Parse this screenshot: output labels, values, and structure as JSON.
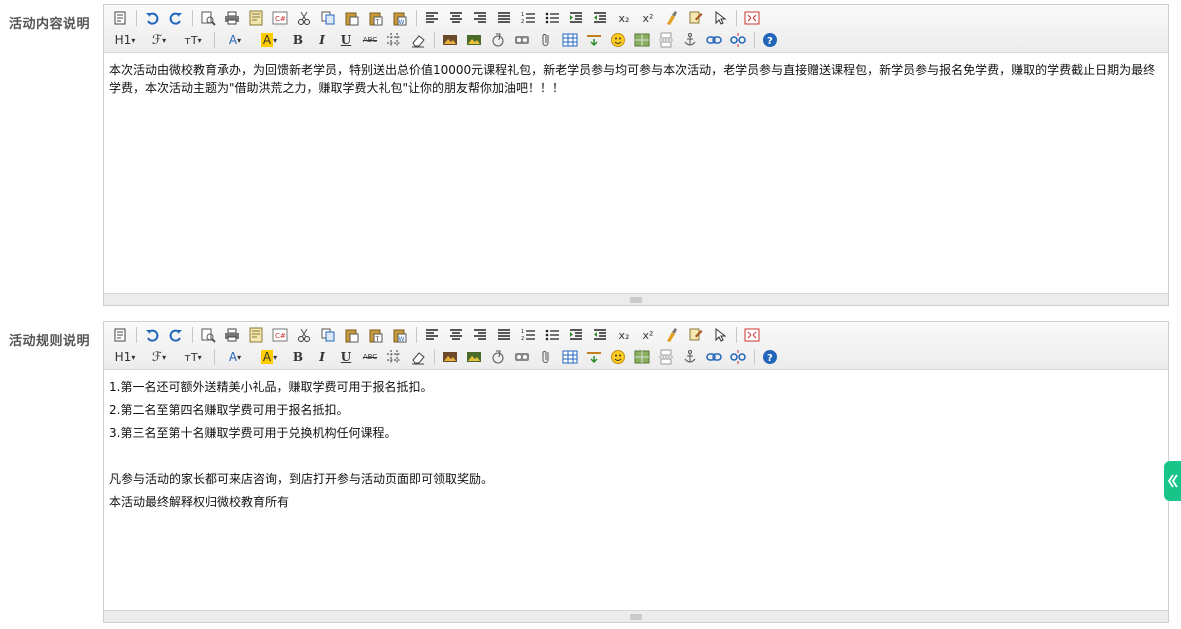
{
  "fields": [
    {
      "label": "活动内容说明",
      "paragraphs": [
        "本次活动由微校教育承办，为回馈新老学员，特别送出总价值10000元课程礼包，新老学员参与均可参与本次活动，老学员参与直接赠送课程包，新学员参与报名免学费，赚取的学费截止日期为最终学费，本次活动主题为\"借助洪荒之力，赚取学费大礼包\"让你的朋友帮你加油吧！！！"
      ]
    },
    {
      "label": "活动规则说明",
      "paragraphs": [
        "1.第一名还可额外送精美小礼品，赚取学费可用于报名抵扣。",
        "2.第二名至第四名赚取学费可用于报名抵扣。",
        "3.第三名至第十名赚取学费可用于兑换机构任何课程。",
        "",
        "凡参与活动的家长都可来店咨询，到店打开参与活动页面即可领取奖励。",
        "本活动最终解释权归微校教育所有"
      ]
    }
  ],
  "toolbar": {
    "heading": "H1",
    "font_family": "ℱ",
    "font_size": "тT",
    "font_color": "A",
    "highlight": "A",
    "bold": "B",
    "italic": "I",
    "underline": "U",
    "strike": "ABC",
    "subscript": "x₂",
    "superscript": "x²"
  },
  "icons": {
    "row1": [
      "source-icon",
      "undo-icon",
      "redo-icon",
      "preview-icon",
      "print-icon",
      "template-icon",
      "code-icon",
      "cut-icon",
      "copy-icon",
      "paste-icon",
      "paste-text-icon",
      "paste-word-icon",
      "align-left-icon",
      "align-center-icon",
      "align-right-icon",
      "justify-icon",
      "ordered-list-icon",
      "unordered-list-icon",
      "indent-icon",
      "outdent-icon",
      "subscript-icon",
      "superscript-icon",
      "clear-format-icon",
      "select-all-icon",
      "cursor-icon",
      "fullscreen-icon"
    ],
    "row2": [
      "heading-icon",
      "font-family-icon",
      "font-size-icon",
      "font-color-icon",
      "highlight-icon",
      "bold-icon",
      "italic-icon",
      "underline-icon",
      "strikethrough-icon",
      "line-height-icon",
      "eraser-icon",
      "image-icon",
      "multi-image-icon",
      "flash-icon",
      "media-icon",
      "attachment-icon",
      "table-icon",
      "hr-icon",
      "emoticon-icon",
      "map-icon",
      "pagebreak-icon",
      "anchor-icon",
      "link-icon",
      "unlink-icon",
      "help-icon"
    ]
  },
  "colors": {
    "accent": "#17c589",
    "highlight": "#ffcc00",
    "blue_icon": "#2266bb"
  }
}
